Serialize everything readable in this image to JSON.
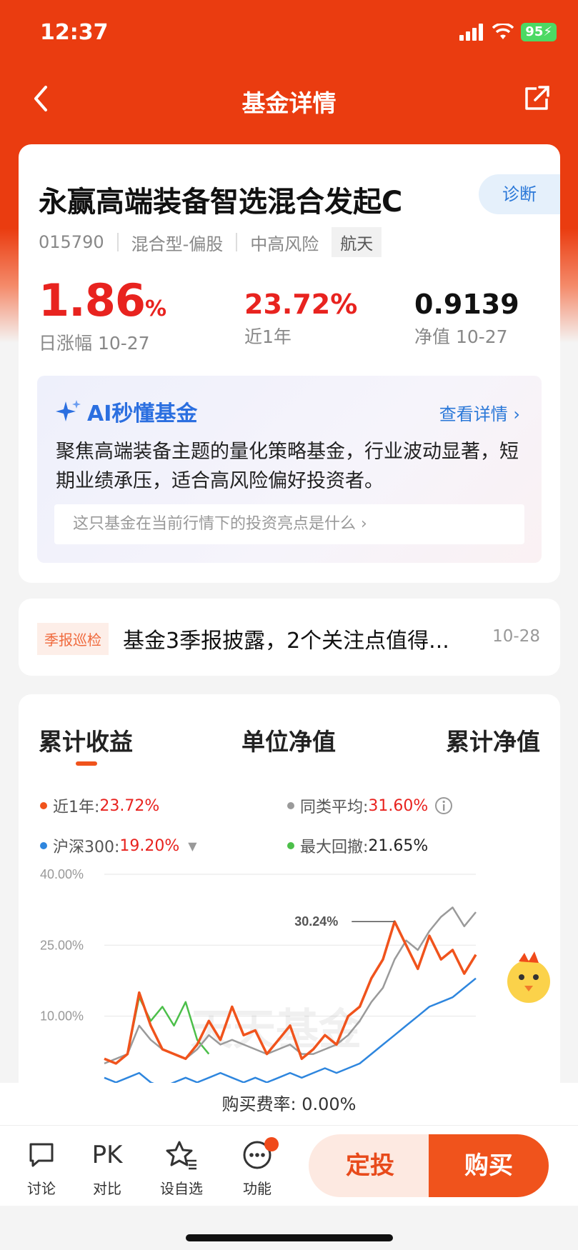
{
  "status": {
    "time": "12:37",
    "battery": "95"
  },
  "nav": {
    "title": "基金详情"
  },
  "fund": {
    "name": "永赢高端装备智选混合发起C",
    "diagnose_label": "诊断",
    "code": "015790",
    "type": "混合型-偏股",
    "risk": "中高风险",
    "tag": "航天",
    "daily_change_value": "1.86",
    "daily_change_unit": "%",
    "daily_change_label": "日涨幅 10-27",
    "year_return": "23.72%",
    "year_return_label": "近1年",
    "nav_value": "0.9139",
    "nav_label": "净值 10-27"
  },
  "ai": {
    "title": "AI秒懂基金",
    "more": "查看详情",
    "summary": "聚焦高端装备主题的量化策略基金，行业波动显著，短期业绩承压，适合高风险偏好投资者。",
    "question": "这只基金在当前行情下的投资亮点是什么"
  },
  "news": {
    "tag": "季报巡检",
    "headline": "基金3季报披露，2个关注点值得...",
    "date": "10-28"
  },
  "chart_tabs": [
    "累计收益",
    "单位净值",
    "累计净值"
  ],
  "legend": {
    "year_label": "近1年:",
    "year_value": "23.72%",
    "peer_label": "同类平均:",
    "peer_value": "31.60%",
    "hs300_label": "沪深300:",
    "hs300_value": "19.20%",
    "drawdown_label": "最大回撤:",
    "drawdown_value": "21.65%"
  },
  "chart_data": {
    "type": "line",
    "yticks": [
      "40.00%",
      "25.00%",
      "10.00%"
    ],
    "ylim": [
      -5,
      40
    ],
    "annotation": "30.24%",
    "watermark": "天天基金",
    "series": [
      {
        "name": "近1年",
        "color": "#f0531c",
        "values": [
          1,
          0,
          2,
          15,
          8,
          3,
          2,
          1,
          4,
          9,
          5,
          12,
          6,
          7,
          2,
          5,
          8,
          1,
          3,
          6,
          4,
          10,
          12,
          18,
          22,
          30,
          25,
          20,
          27,
          22,
          24,
          19,
          23
        ]
      },
      {
        "name": "同类平均",
        "color": "#9a9a9a",
        "values": [
          0,
          1,
          2,
          8,
          5,
          3,
          2,
          1,
          3,
          6,
          4,
          5,
          4,
          3,
          2,
          3,
          4,
          2,
          2,
          3,
          4,
          6,
          9,
          13,
          16,
          22,
          26,
          24,
          28,
          31,
          33,
          29,
          32
        ]
      },
      {
        "name": "沪深300",
        "color": "#2e86de",
        "values": [
          -3,
          -4,
          -3,
          -2,
          -4,
          -5,
          -4,
          -3,
          -4,
          -3,
          -2,
          -3,
          -4,
          -3,
          -4,
          -3,
          -2,
          -3,
          -2,
          -1,
          -2,
          -1,
          0,
          2,
          4,
          6,
          8,
          10,
          12,
          13,
          14,
          16,
          18
        ]
      },
      {
        "name": "最大回撤",
        "color": "#4cbf4a",
        "values": [
          null,
          null,
          2,
          14,
          9,
          12,
          8,
          13,
          5,
          2,
          null,
          null,
          null,
          null,
          null,
          null,
          null,
          null,
          null,
          null,
          null,
          null,
          null,
          null,
          null,
          null,
          null,
          null,
          null,
          null,
          null,
          null,
          null
        ]
      }
    ]
  },
  "fee": "购买费率: 0.00%",
  "bottom": {
    "discuss": "讨论",
    "pk_icon": "PK",
    "pk": "对比",
    "watchlist": "设自选",
    "functions": "功能",
    "dingtou": "定投",
    "buy": "购买"
  }
}
